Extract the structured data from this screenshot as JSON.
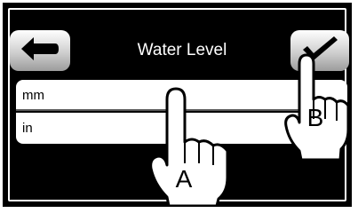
{
  "header": {
    "title": "Water Level",
    "back_icon": "left-arrow-icon",
    "confirm_icon": "check-icon"
  },
  "list": {
    "items": [
      {
        "label": "mm"
      },
      {
        "label": "in"
      }
    ]
  },
  "callouts": {
    "a_label": "A",
    "b_label": "B"
  },
  "colors": {
    "screen_bg": "#000000",
    "frame": "#ffffff",
    "button_light": "#ffffff",
    "button_dark": "#9c9c9c"
  }
}
